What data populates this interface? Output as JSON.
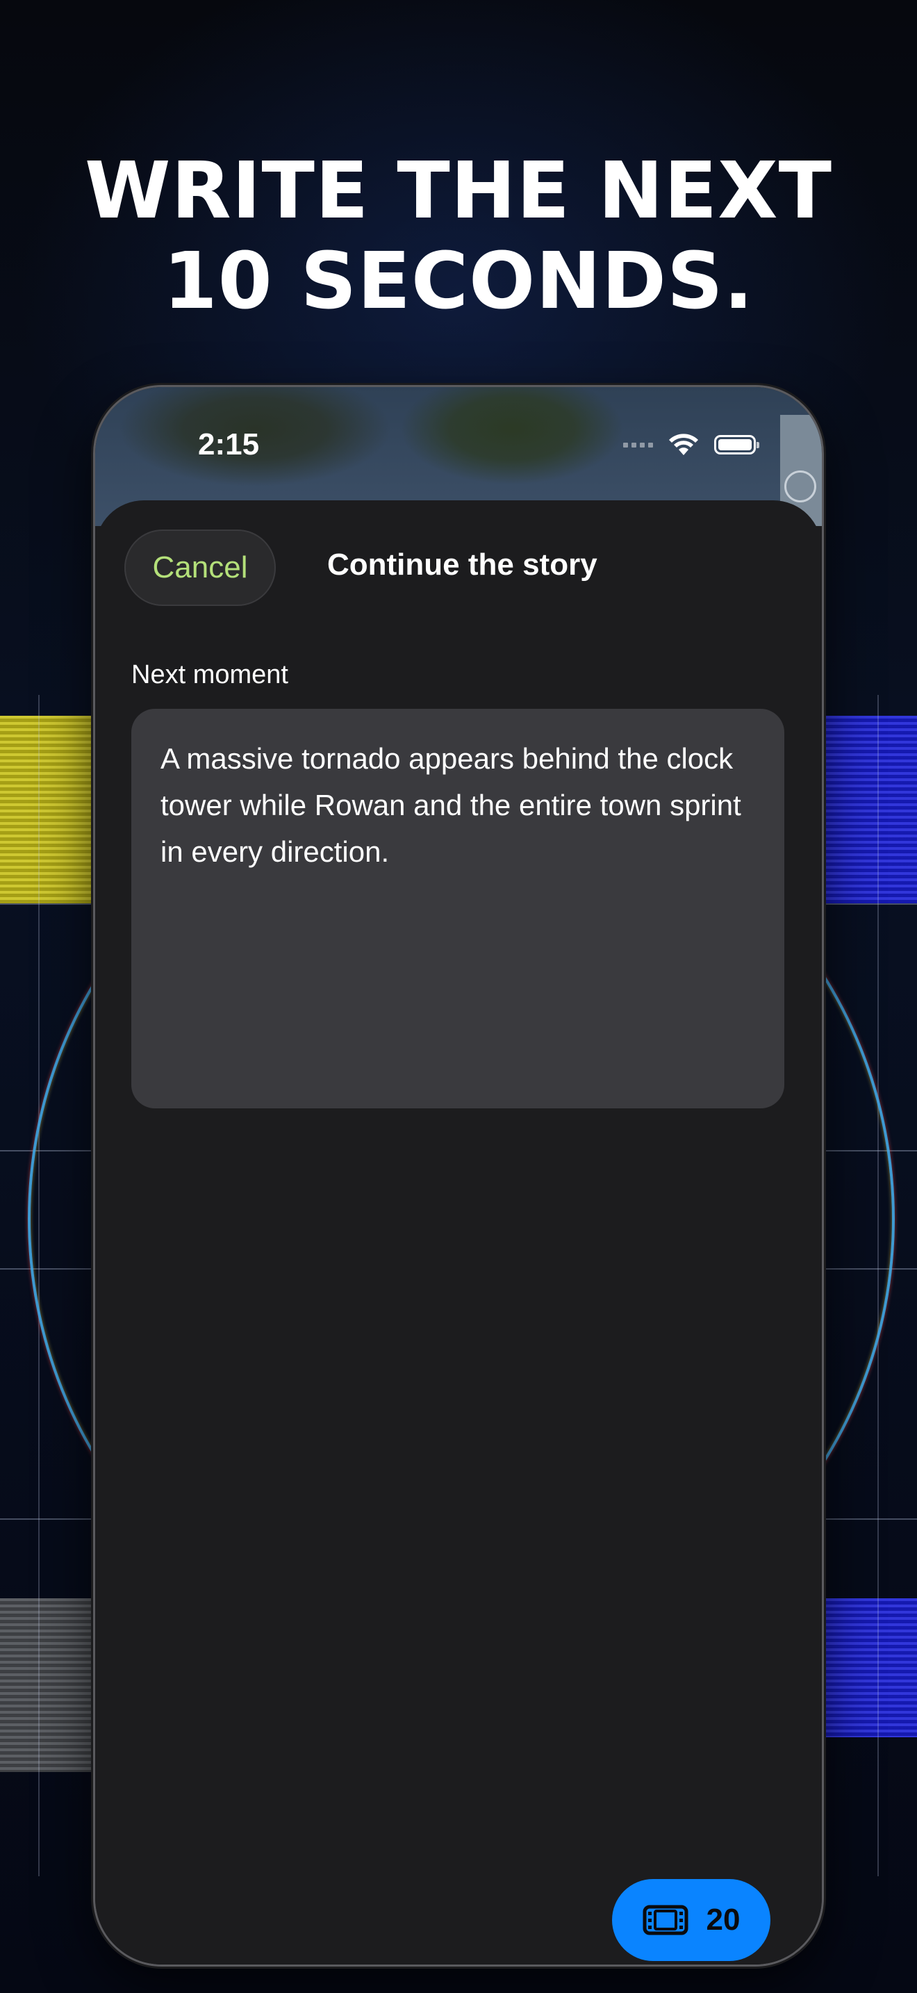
{
  "headline": {
    "line1": "WRITE THE NEXT",
    "line2": "10 SECONDS."
  },
  "status_bar": {
    "time": "2:15",
    "icons": [
      "signal-dots-icon",
      "wifi-icon",
      "battery-icon"
    ]
  },
  "sheet": {
    "cancel_label": "Cancel",
    "title": "Continue the story",
    "field_label": "Next moment",
    "field_value": "A massive tornado appears behind the clock tower while Rowan and the entire town sprint in every direction."
  },
  "credit_button": {
    "icon": "film-icon",
    "count": "20"
  },
  "colors": {
    "accent_green": "#b4e07a",
    "accent_blue": "#0a84ff",
    "sheet_bg": "#1c1c1e",
    "field_bg": "#3a3a3e"
  }
}
